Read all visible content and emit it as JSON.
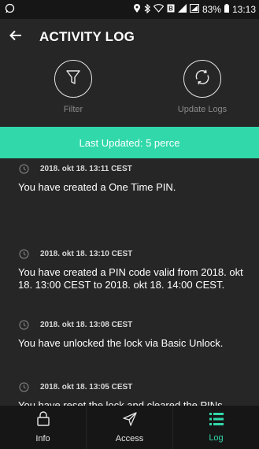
{
  "status_bar": {
    "battery_percent": "83%",
    "time": "13:13"
  },
  "header": {
    "title": "ACTIVITY LOG"
  },
  "actions": {
    "filter_label": "Filter",
    "update_label": "Update Logs"
  },
  "banner": {
    "text": "Last Updated: 5 perce"
  },
  "logs": [
    {
      "time": "2018. okt 18. 13:11 CEST",
      "message": "You have created a One Time PIN."
    },
    {
      "time": "2018. okt 18. 13:10 CEST",
      "message": "You have created a PIN code valid from 2018. okt 18. 13:00 CEST to 2018. okt 18. 14:00 CEST."
    },
    {
      "time": "2018. okt 18. 13:08 CEST",
      "message": "You have unlocked the lock via Basic Unlock."
    },
    {
      "time": "2018. okt 18. 13:05 CEST",
      "message": "You have reset the lock and cleared the PINs."
    }
  ],
  "nav": {
    "info_label": "Info",
    "access_label": "Access",
    "log_label": "Log"
  },
  "colors": {
    "accent": "#31d8aa",
    "background": "#262626",
    "bars": "#161616"
  },
  "icons": {
    "back": "arrow-left-icon",
    "filter": "funnel-icon",
    "update": "refresh-icon",
    "timestamp": "clock-icon",
    "info": "lock-icon",
    "access": "send-icon",
    "log": "list-icon"
  }
}
